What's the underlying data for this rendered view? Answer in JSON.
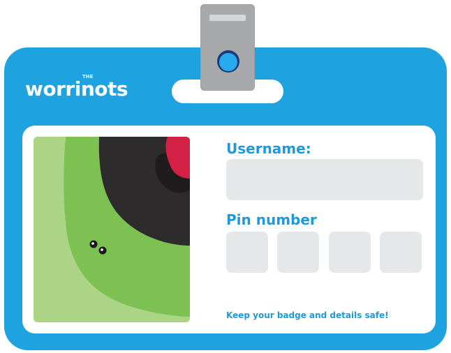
{
  "brand": {
    "logo_text": "worrinots",
    "logo_prefix": "THE"
  },
  "form": {
    "username_label": "Username:",
    "username_value": "",
    "pin_label": "Pin number",
    "pin_values": [
      "",
      "",
      "",
      ""
    ],
    "safety_note": "Keep your badge and details safe!"
  },
  "icons": {
    "clip": "badge-clip-icon",
    "avatar": "worrinot-creature-avatar"
  },
  "colors": {
    "badge_blue": "#1fa3e0",
    "label_blue": "#1f99d8",
    "field_grey": "#e6e7e8",
    "creature_green": "#7cc152",
    "accent_red": "#d62147"
  }
}
